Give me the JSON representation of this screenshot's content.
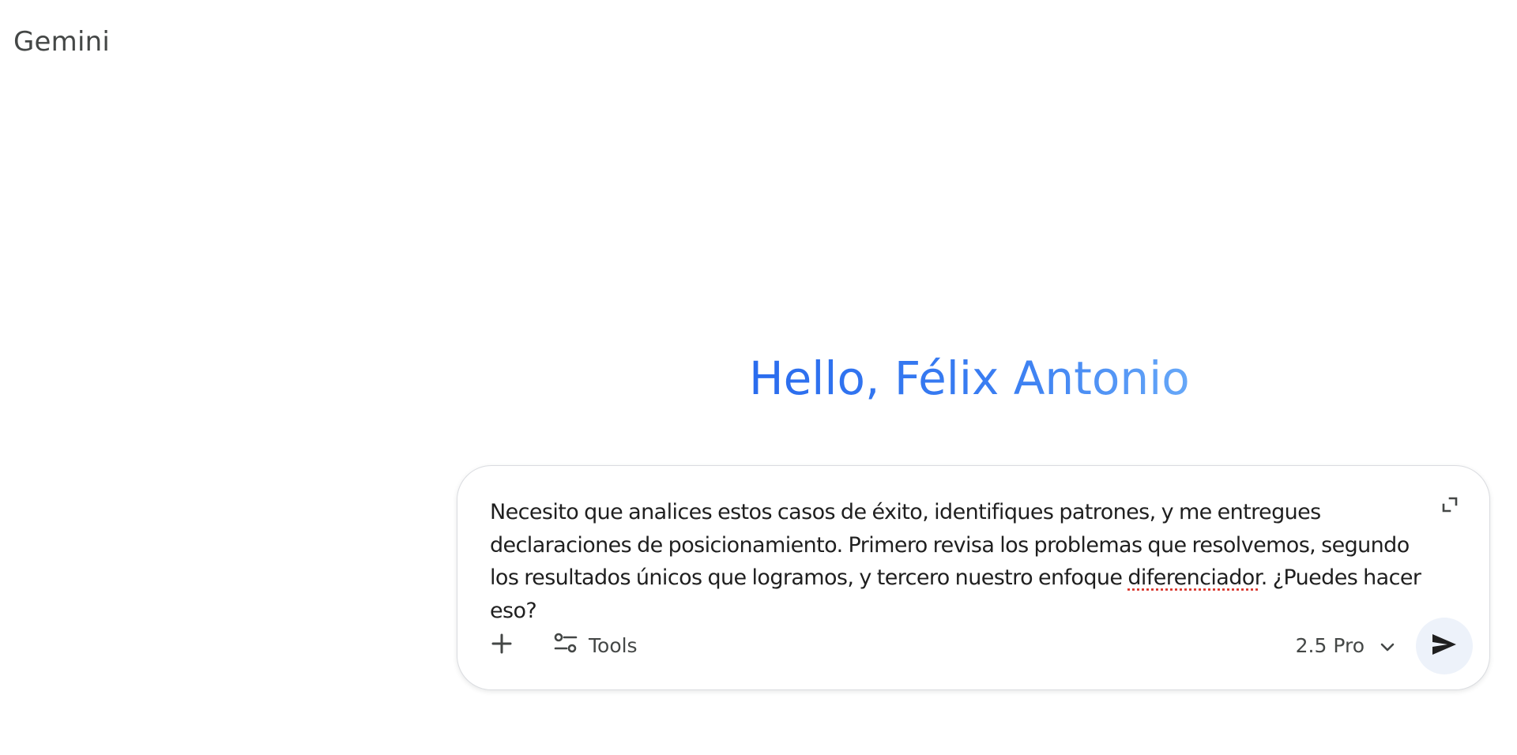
{
  "app": {
    "title": "Gemini"
  },
  "main": {
    "greeting": "Hello, Félix Antonio"
  },
  "composer": {
    "text_before": "Necesito que analices estos casos de éxito, identifiques patrones, y me entregues declaraciones de posicionamiento. Primero revisa los problemas que resolvemos, segundo los resultados únicos que logramos, y tercero nuestro enfoque ",
    "text_misspelled": "diferenciador",
    "text_after": ". ¿Puedes hacer eso?",
    "tools_label": "Tools",
    "model_label": "2.5 Pro"
  },
  "icons": {
    "add": "plus-icon",
    "tools": "tools-sliders-icon",
    "model_dropdown": "chevron-down-icon",
    "send": "send-arrow-icon",
    "expand": "expand-corners-icon"
  },
  "colors": {
    "greeting_gradient_start": "#2a6cee",
    "greeting_gradient_end": "#67a8f8",
    "send_button_bg": "#edf2fa",
    "spellcheck": "#d93025"
  }
}
